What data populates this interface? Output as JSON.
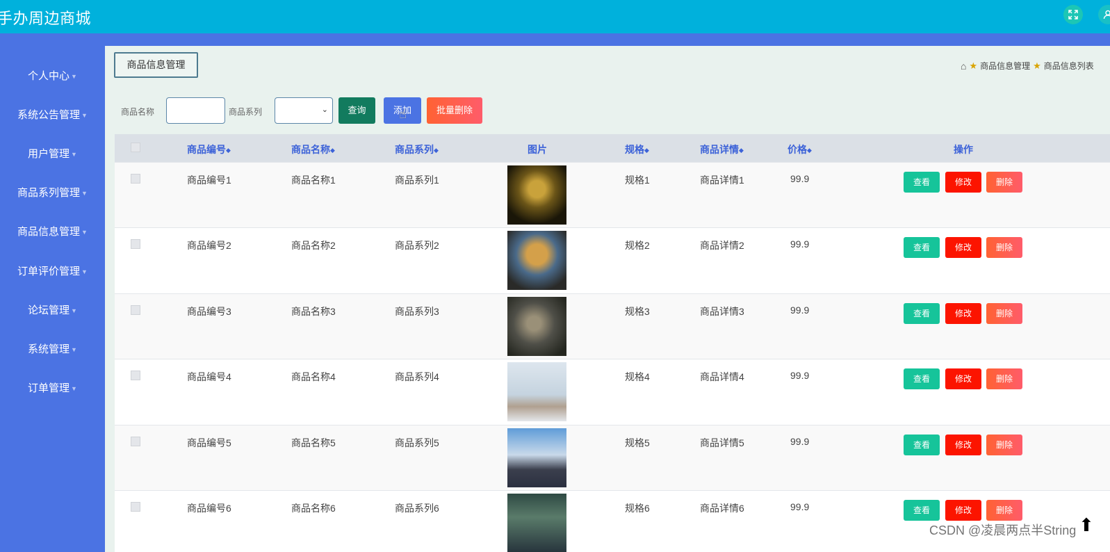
{
  "header": {
    "title": "手办周边商城",
    "expand_icon": "expand-icon",
    "user_icon": "user-icon"
  },
  "sidebar": {
    "items": [
      {
        "label": "个人中心"
      },
      {
        "label": "系统公告管理"
      },
      {
        "label": "用户管理"
      },
      {
        "label": "商品系列管理"
      },
      {
        "label": "商品信息管理"
      },
      {
        "label": "订单评价管理"
      },
      {
        "label": "论坛管理"
      },
      {
        "label": "系统管理"
      },
      {
        "label": "订单管理"
      }
    ]
  },
  "module_tag": "商品信息管理",
  "breadcrumb": {
    "first": "商品信息管理",
    "second": "商品信息列表"
  },
  "search": {
    "name_label": "商品名称",
    "name_value": "",
    "series_label": "商品系列",
    "series_value": "",
    "query_button": "查询",
    "add_button": "添加",
    "batch_delete_button": "批量删除"
  },
  "table": {
    "headers": {
      "code": "商品编号",
      "name": "商品名称",
      "series": "商品系列",
      "image": "图片",
      "spec": "规格",
      "detail": "商品详情",
      "price": "价格",
      "actions": "操作"
    },
    "rows": [
      {
        "code": "商品编号1",
        "name": "商品名称1",
        "series": "商品系列1",
        "spec": "规格1",
        "detail": "商品详情1",
        "price": "99.9"
      },
      {
        "code": "商品编号2",
        "name": "商品名称2",
        "series": "商品系列2",
        "spec": "规格2",
        "detail": "商品详情2",
        "price": "99.9"
      },
      {
        "code": "商品编号3",
        "name": "商品名称3",
        "series": "商品系列3",
        "spec": "规格3",
        "detail": "商品详情3",
        "price": "99.9"
      },
      {
        "code": "商品编号4",
        "name": "商品名称4",
        "series": "商品系列4",
        "spec": "规格4",
        "detail": "商品详情4",
        "price": "99.9"
      },
      {
        "code": "商品编号5",
        "name": "商品名称5",
        "series": "商品系列5",
        "spec": "规格5",
        "detail": "商品详情5",
        "price": "99.9"
      },
      {
        "code": "商品编号6",
        "name": "商品名称6",
        "series": "商品系列6",
        "spec": "规格6",
        "detail": "商品详情6",
        "price": "99.9"
      }
    ],
    "row_actions": {
      "view": "查看",
      "edit": "修改",
      "delete": "删除"
    }
  },
  "watermark": "CSDN @凌晨两点半String"
}
